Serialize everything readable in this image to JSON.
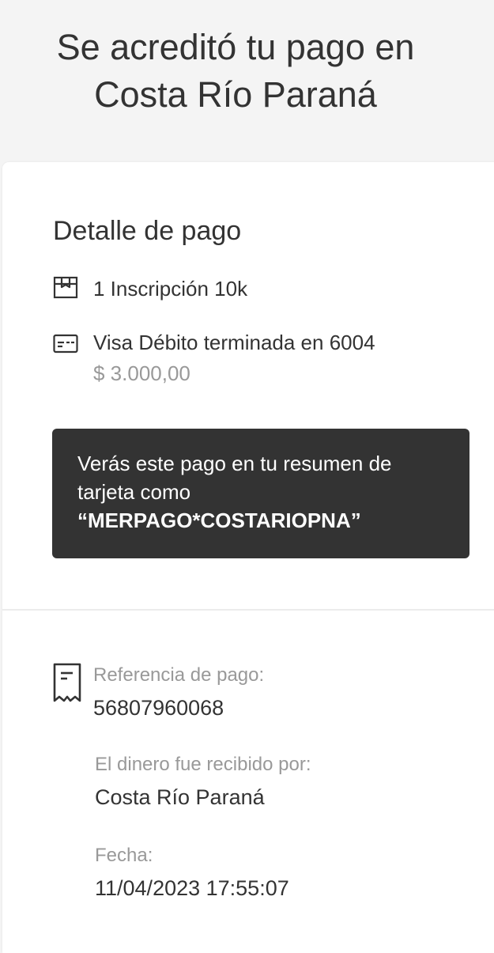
{
  "header": {
    "title_line1": "Se acreditó tu pago en",
    "title_line2": "Costa Río Paraná"
  },
  "detail": {
    "title": "Detalle de pago",
    "item": {
      "icon": "package-icon",
      "text": "1 Inscripción 10k"
    },
    "payment": {
      "icon": "credit-card-icon",
      "method": "Visa Débito terminada en 6004",
      "amount": "$ 3.000,00"
    }
  },
  "notice": {
    "line1": "Verás este pago en tu resumen de",
    "line2": "tarjeta como",
    "descriptor": "“MERPAGO*COSTARIOPNA”"
  },
  "info": {
    "icon": "receipt-icon",
    "reference_label": "Referencia de pago:",
    "reference_value": "56807960068",
    "receiver_label": "El dinero fue recibido por:",
    "receiver_value": "Costa Río Paraná",
    "date_label": "Fecha:",
    "date_value": "11/04/2023 17:55:07"
  },
  "colors": {
    "header_background": "#f4f4f4",
    "card_background": "#ffffff",
    "notice_background": "#333333",
    "text_primary": "#333333",
    "text_secondary": "#999999"
  }
}
